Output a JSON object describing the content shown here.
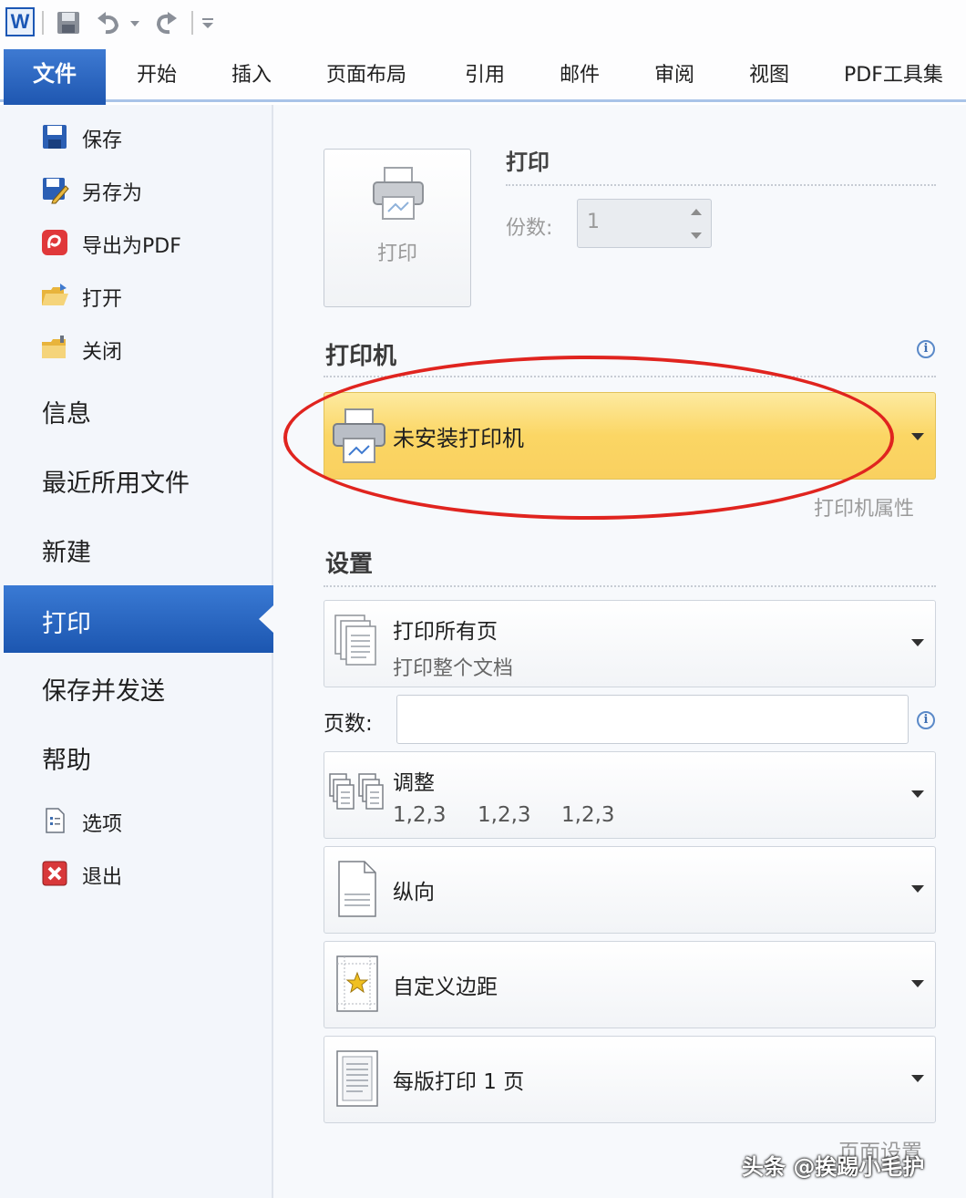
{
  "app": {
    "logo_letter": "W",
    "accent_color": "#1e56b0",
    "highlight_color": "#fbd664",
    "annotation_color": "#e0241f"
  },
  "ribbon": {
    "file_tab": "文件",
    "tabs": [
      "开始",
      "插入",
      "页面布局",
      "引用",
      "邮件",
      "审阅",
      "视图",
      "PDF工具集"
    ]
  },
  "nav": {
    "commands_top": [
      {
        "label": "保存",
        "icon": "save-icon"
      },
      {
        "label": "另存为",
        "icon": "save-as-icon"
      },
      {
        "label": "导出为PDF",
        "icon": "export-pdf-icon"
      },
      {
        "label": "打开",
        "icon": "open-folder-icon"
      },
      {
        "label": "关闭",
        "icon": "close-folder-icon"
      }
    ],
    "tabs": [
      "信息",
      "最近所用文件",
      "新建",
      "打印",
      "保存并发送",
      "帮助"
    ],
    "active_tab": "打印",
    "commands_bottom": [
      {
        "label": "选项",
        "icon": "options-icon"
      },
      {
        "label": "退出",
        "icon": "exit-icon"
      }
    ]
  },
  "print": {
    "button_label": "打印",
    "heading": "打印",
    "copies_label": "份数:",
    "copies_value": "1"
  },
  "printer": {
    "heading": "打印机",
    "selected": "未安装打印机",
    "properties_link": "打印机属性"
  },
  "settings": {
    "heading": "设置",
    "range": {
      "title": "打印所有页",
      "subtitle": "打印整个文档"
    },
    "pages_label": "页数:",
    "pages_value": "",
    "collate": {
      "title": "调整",
      "sub": [
        "1,2,3",
        "1,2,3",
        "1,2,3"
      ]
    },
    "orientation": "纵向",
    "margins": "自定义边距",
    "per_sheet": "每版打印 1 页",
    "page_setup_link": "页面设置"
  },
  "watermark": "头条 @挨踢小毛护"
}
